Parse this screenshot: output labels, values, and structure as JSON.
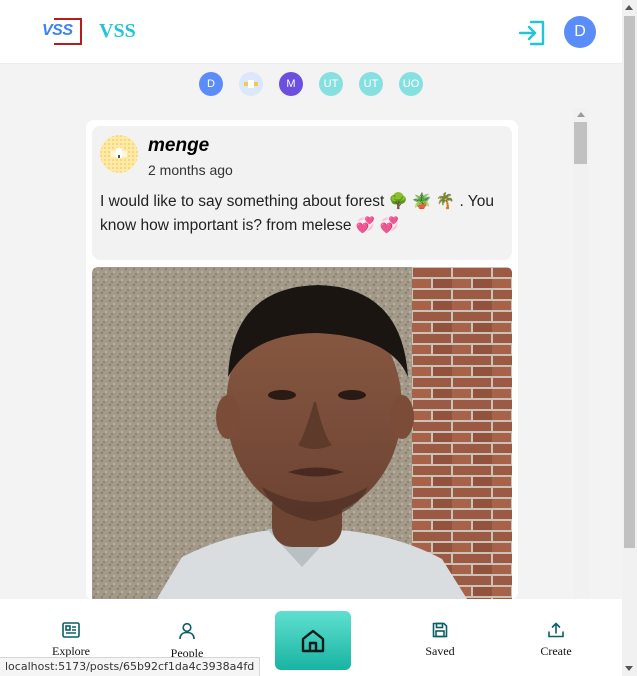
{
  "header": {
    "logo_text": "VSS",
    "brand": "VSS",
    "user_initial": "D",
    "accent": "#22c5d8",
    "logo_red": "#b71c1c"
  },
  "stories": [
    {
      "label": "D",
      "color": "#5b8dfa",
      "icon": "initial"
    },
    {
      "label": "",
      "color": "#dbe8fb",
      "icon": "image-avatar"
    },
    {
      "label": "M",
      "color": "#6d4fe0",
      "icon": "initial"
    },
    {
      "label": "UT",
      "color": "#87e0e0",
      "icon": "initial"
    },
    {
      "label": "UT",
      "color": "#87e0e0",
      "icon": "initial"
    },
    {
      "label": "UO",
      "color": "#87e0e0",
      "icon": "initial"
    }
  ],
  "post": {
    "author": "menge",
    "time": "2 months ago",
    "text": "I would like to say something about forest 🌳 🪴 🌴 . You know how important is? from melese 💞 💞",
    "image_icon": "portrait-photo"
  },
  "nav": {
    "items": [
      {
        "label": "Explore",
        "icon": "newspaper-icon"
      },
      {
        "label": "People",
        "icon": "person-icon"
      },
      {
        "label": "",
        "icon": "home-icon"
      },
      {
        "label": "Saved",
        "icon": "save-icon"
      },
      {
        "label": "Create",
        "icon": "upload-icon"
      }
    ],
    "home_gradient": [
      "#5fe0d0",
      "#19b3a2"
    ]
  },
  "status_bar": {
    "url": "localhost:5173/posts/65b92cf1da4c3938a4fd"
  }
}
